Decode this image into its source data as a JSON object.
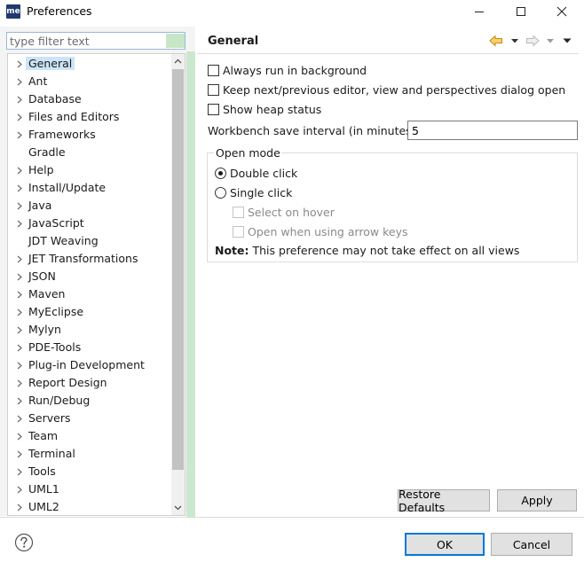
{
  "window": {
    "logo_text": "me",
    "title": "Preferences"
  },
  "filter": {
    "placeholder": "type filter text"
  },
  "tree": {
    "items": [
      {
        "label": "General",
        "expandable": true,
        "selected": true
      },
      {
        "label": "Ant",
        "expandable": true
      },
      {
        "label": "Database",
        "expandable": true
      },
      {
        "label": "Files and Editors",
        "expandable": true
      },
      {
        "label": "Frameworks",
        "expandable": true
      },
      {
        "label": "Gradle",
        "expandable": false
      },
      {
        "label": "Help",
        "expandable": true
      },
      {
        "label": "Install/Update",
        "expandable": true
      },
      {
        "label": "Java",
        "expandable": true
      },
      {
        "label": "JavaScript",
        "expandable": true
      },
      {
        "label": "JDT Weaving",
        "expandable": false
      },
      {
        "label": "JET Transformations",
        "expandable": true
      },
      {
        "label": "JSON",
        "expandable": true
      },
      {
        "label": "Maven",
        "expandable": true
      },
      {
        "label": "MyEclipse",
        "expandable": true
      },
      {
        "label": "Mylyn",
        "expandable": true
      },
      {
        "label": "PDE-Tools",
        "expandable": true
      },
      {
        "label": "Plug-in Development",
        "expandable": true
      },
      {
        "label": "Report Design",
        "expandable": true
      },
      {
        "label": "Run/Debug",
        "expandable": true
      },
      {
        "label": "Servers",
        "expandable": true
      },
      {
        "label": "Team",
        "expandable": true
      },
      {
        "label": "Terminal",
        "expandable": true
      },
      {
        "label": "Tools",
        "expandable": true
      },
      {
        "label": "UML1",
        "expandable": true
      },
      {
        "label": "UML2",
        "expandable": true
      }
    ]
  },
  "page": {
    "title": "General",
    "options": {
      "always_run_background": {
        "label": "Always run in background",
        "checked": false
      },
      "keep_next_previous": {
        "label": "Keep next/previous editor, view and perspectives dialog open",
        "checked": false
      },
      "show_heap_status": {
        "label": "Show heap status",
        "checked": false
      }
    },
    "save_interval": {
      "label": "Workbench save interval (in minutes):",
      "value": "5"
    },
    "open_mode": {
      "title": "Open mode",
      "double_click": {
        "label": "Double click",
        "selected": true
      },
      "single_click": {
        "label": "Single click",
        "selected": false
      },
      "select_on_hover": {
        "label": "Select on hover",
        "enabled": false
      },
      "open_arrow_keys": {
        "label": "Open when using arrow keys",
        "enabled": false
      }
    },
    "note": {
      "prefix": "Note:",
      "text": " This preference may not take effect on all views"
    },
    "buttons": {
      "restore_defaults": "Restore Defaults",
      "apply": "Apply"
    }
  },
  "dialog_buttons": {
    "ok": "OK",
    "cancel": "Cancel"
  },
  "colors": {
    "accent": "#0078d7",
    "selection": "#cce4f7",
    "nav_back": "#e8a317"
  }
}
